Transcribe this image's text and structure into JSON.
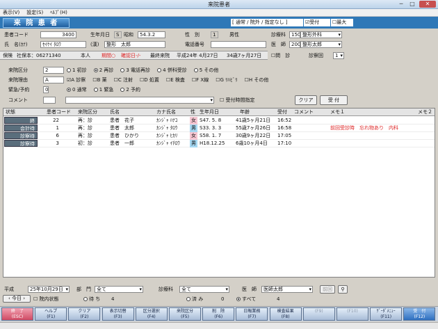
{
  "window": {
    "title": "来院患者"
  },
  "menu": [
    "表示(V)",
    "設定(S)",
    "ﾍﾙﾌﾟ(H)"
  ],
  "header": {
    "title": "来 院 患 者",
    "options": "[ 通常 / 院外 / 指定なし ]",
    "reception_label": "受付",
    "reception_checked": "☑",
    "max_label": "最大",
    "max_checked": "☐"
  },
  "patient": {
    "code_label": "患者コード",
    "code": "3400",
    "birth_label": "生年月日",
    "era_code": "S",
    "era": "昭和",
    "birth": "54.3.2",
    "sex_label": "性　別",
    "sex_code": "1",
    "sex": "男性",
    "dept_label": "診療科",
    "dept_code": "150",
    "dept": "整形外科",
    "kana_label": "氏　名(ｶﾅ)",
    "kana": "ｾｲｹｲ ﾀﾛｳ",
    "kanji_label": "(漢)",
    "kanji": "整形　太郎",
    "phone_label": "電話番号",
    "phone": "",
    "doctor_label": "医　師",
    "doctor_code": "200",
    "doctor": "整形太郎",
    "question_label": "問　診",
    "question_checked": "☐",
    "visit_label": "診察回",
    "visit": "1"
  },
  "insurance": {
    "text1": "保険",
    "text2": "社保本：06271340",
    "text3": "本人",
    "expired": "期間○",
    "confirm": "確認日-/-",
    "last_label": "最終来院",
    "last": "平成24年 4月27日",
    "age": "34歳7ヶ月27日"
  },
  "form": {
    "visit_type_label": "来院区分",
    "visit_type": "2",
    "visit_types": [
      {
        "label": "1 初診",
        "on": false
      },
      {
        "label": "2 再診",
        "on": true
      },
      {
        "label": "3 電話再診",
        "on": false
      },
      {
        "label": "4 併科受診",
        "on": false
      },
      {
        "label": "5 その他",
        "on": false
      }
    ],
    "reason_label": "来院理由",
    "reason": "A",
    "reasons": [
      {
        "mark": "☑",
        "label": "A 診察"
      },
      {
        "mark": "☐",
        "label": "B 薬"
      },
      {
        "mark": "☐",
        "label": "C 注射"
      },
      {
        "mark": "☐",
        "label": "D 処置"
      },
      {
        "mark": "☐",
        "label": "E 検査"
      },
      {
        "mark": "☐",
        "label": "F X線"
      },
      {
        "mark": "☐",
        "label": "G ﾘﾊﾋﾞﾘ"
      },
      {
        "mark": "☐",
        "label": "H その他"
      }
    ],
    "urgent_label": "緊急/予約",
    "urgent": "0",
    "urgents": [
      {
        "label": "0 通常",
        "on": true
      },
      {
        "label": "1 緊急",
        "on": false
      },
      {
        "label": "2 予約",
        "on": false
      }
    ],
    "comment_label": "コメント",
    "comment": "",
    "time_label": "受付時間指定",
    "time_checked": "☐",
    "clear_btn": "クリア",
    "accept_btn": "受 付"
  },
  "table": {
    "headers": [
      "状態",
      "患者コード",
      "来院区分",
      "氏名",
      "カナ氏名",
      "性",
      "生年月日",
      "年齢",
      "受付",
      "コメント",
      "メモ１",
      "メモ２"
    ],
    "rows": [
      {
        "status": "終",
        "code": "22",
        "type": "再：診",
        "name": "患者　花子",
        "kana": "ｶﾝｼﾞｬ ﾊﾅｺ",
        "sex": "女",
        "birth": "S47. 5. 8",
        "age": "41歳5ヶ月21日",
        "time": "16:52",
        "memo": ""
      },
      {
        "status": "会計待",
        "code": "1",
        "type": "再：診",
        "name": "患者　太郎",
        "kana": "ｶﾝｼﾞｬ ﾀﾛｳ",
        "sex": "男",
        "birth": "S33. 3. 3",
        "age": "55歳7ヶ月26日",
        "time": "16:58",
        "memo": "前回受診時　忘れ物あり　内科"
      },
      {
        "status": "診察待",
        "code": "6",
        "type": "再：診",
        "name": "患者　ひかり",
        "kana": "ｶﾝｼﾞｬ ﾋｶﾘ",
        "sex": "女",
        "birth": "S58. 1. 7",
        "age": "30歳9ヶ月22日",
        "time": "17:05",
        "memo": ""
      },
      {
        "status": "診察待",
        "code": "3",
        "type": "初：診",
        "name": "患者　一郎",
        "kana": "ｶﾝｼﾞｬ ｲﾁﾛｳ",
        "sex": "男",
        "birth": "H18.12.25",
        "age": "6歳10ヶ月4日",
        "time": "17:10",
        "memo": ""
      }
    ]
  },
  "bottom": {
    "era": "平成",
    "date": "25年10月29日",
    "today_btn": "今日",
    "ward_label": "院内状態",
    "ward_checked": "☐",
    "dept_label": "部　門",
    "dept": "全て",
    "clinic_label": "診療科",
    "clinic": "全て",
    "doctor_label": "医　師",
    "doctor": "医師太郎",
    "wait_label": "待 ち",
    "wait": "4",
    "done_label": "済 み",
    "done": "0",
    "all_label": "すべて",
    "all": "4",
    "refresh_btn": "前回"
  },
  "fkeys": [
    {
      "l1": "終　了",
      "l2": "(ESC)",
      "style": "red"
    },
    {
      "l1": "ヘルプ",
      "l2": "(F1)",
      "style": ""
    },
    {
      "l1": "クリア",
      "l2": "(F2)",
      "style": ""
    },
    {
      "l1": "表示切替",
      "l2": "(F3)",
      "style": ""
    },
    {
      "l1": "区分選択",
      "l2": "(F4)",
      "style": ""
    },
    {
      "l1": "来院区分",
      "l2": "(F5)",
      "style": ""
    },
    {
      "l1": "削　除",
      "l2": "(F6)",
      "style": ""
    },
    {
      "l1": "日報業務",
      "l2": "(F7)",
      "style": ""
    },
    {
      "l1": "検査結果",
      "l2": "(F8)",
      "style": ""
    },
    {
      "l1": "",
      "l2": "(F9)",
      "style": "dim"
    },
    {
      "l1": "",
      "l2": "(F10)",
      "style": "dim"
    },
    {
      "l1": "ｹﾞｰﾀﾞﾒﾆｭｰ",
      "l2": "(F11)",
      "style": ""
    },
    {
      "l1": "受　付",
      "l2": "(F12)",
      "style": "blue"
    }
  ]
}
